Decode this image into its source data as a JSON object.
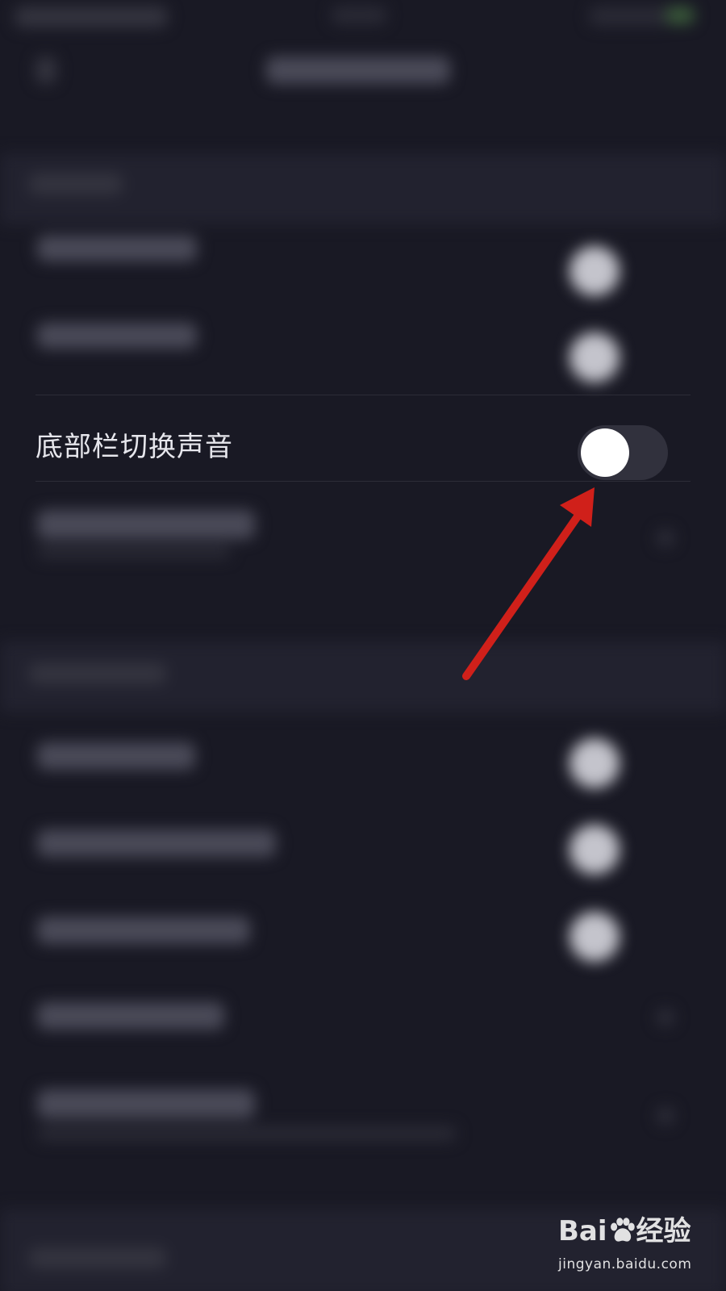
{
  "setting_row": {
    "label": "底部栏切换声音",
    "toggle_state": "off"
  },
  "annotation": {
    "arrow_color": "#d0201a",
    "target": "toggle-switch"
  },
  "watermark": {
    "brand_left": "Bai",
    "brand_right": "经验",
    "url": "jingyan.baidu.com",
    "icon": "baidu-paw-icon"
  },
  "colors": {
    "background": "#191924",
    "label_text": "#e6e6ec",
    "switch_track": "#31313d",
    "switch_knob": "#ffffff"
  }
}
